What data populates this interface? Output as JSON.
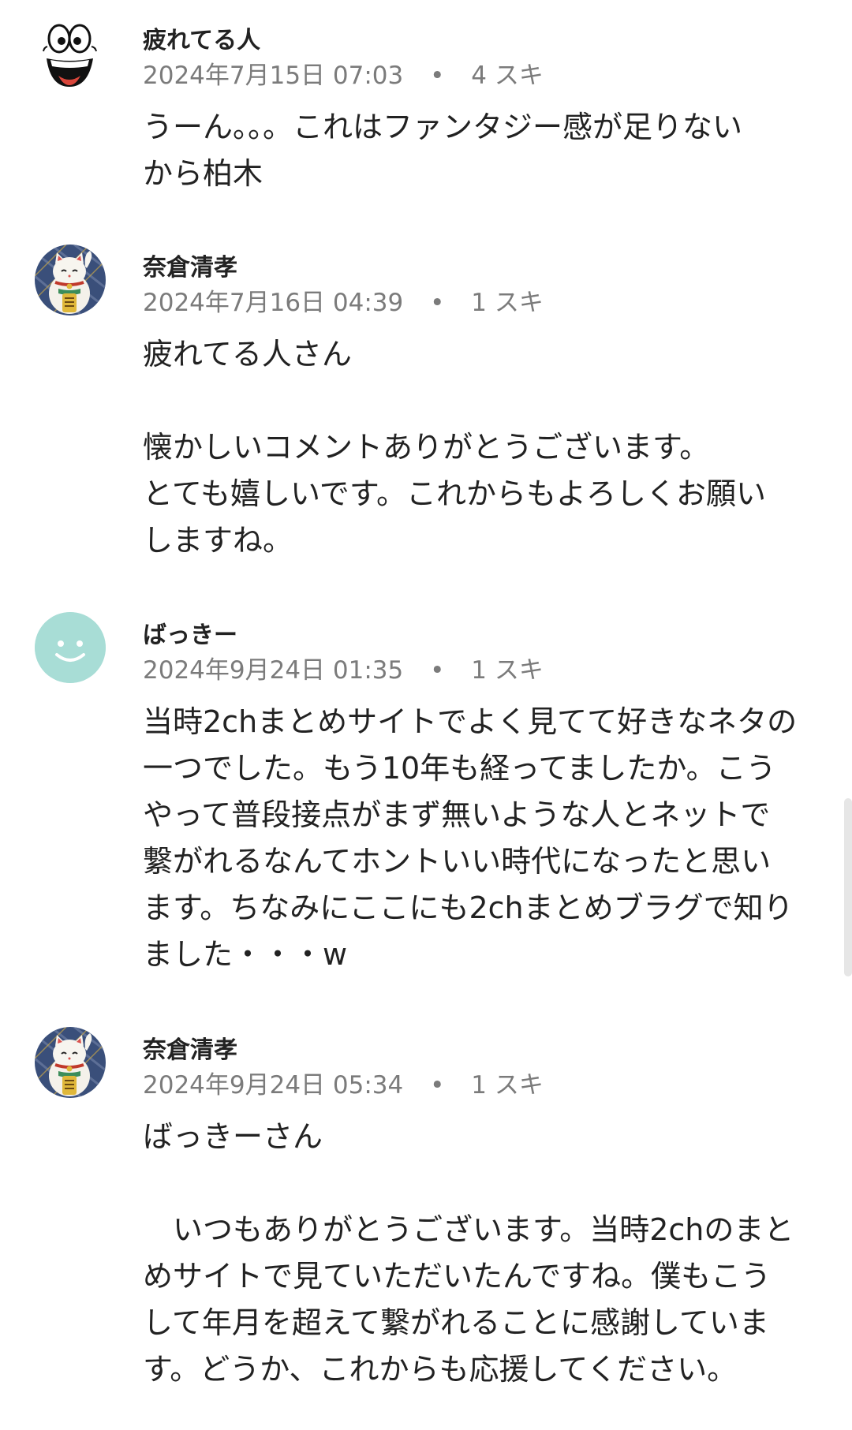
{
  "comments": [
    {
      "author": "疲れてる人",
      "date": "2024年7月15日 07:03",
      "separator": "•",
      "likes": "4 スキ",
      "avatar_icon": "cartoon-face-icon",
      "lines": [
        "うーん。。。これはファンタジー感が足りない",
        "から柏木"
      ]
    },
    {
      "author": "奈倉清孝",
      "date": "2024年7月16日 04:39",
      "separator": "•",
      "likes": "1 スキ",
      "avatar_icon": "maneki-neko-icon",
      "lines": [
        "疲れてる人さん",
        "",
        "懐かしいコメントありがとうございます。",
        "とても嬉しいです。これからもよろしくお願い",
        "しますね。"
      ]
    },
    {
      "author": "ばっきー",
      "date": "2024年9月24日 01:35",
      "separator": "•",
      "likes": "1 スキ",
      "avatar_icon": "smiley-face-icon",
      "lines": [
        "当時2chまとめサイトでよく見てて好きなネタの",
        "一つでした。もう10年も経ってましたか。こう",
        "やって普段接点がまず無いような人とネットで",
        "繋がれるなんてホントいい時代になったと思い",
        "ます。ちなみにここにも2chまとめブラグで知り",
        "ました・・・w"
      ]
    },
    {
      "author": "奈倉清孝",
      "date": "2024年9月24日 05:34",
      "separator": "•",
      "likes": "1 スキ",
      "avatar_icon": "maneki-neko-icon",
      "lines": [
        "ばっきーさん",
        "",
        "　いつもありがとうございます。当時2chのまと",
        "めサイトで見ていただいたんですね。僕もこう",
        "して年月を超えて繋がれることに感謝していま",
        "す。どうか、これからも応援してください。"
      ]
    }
  ]
}
